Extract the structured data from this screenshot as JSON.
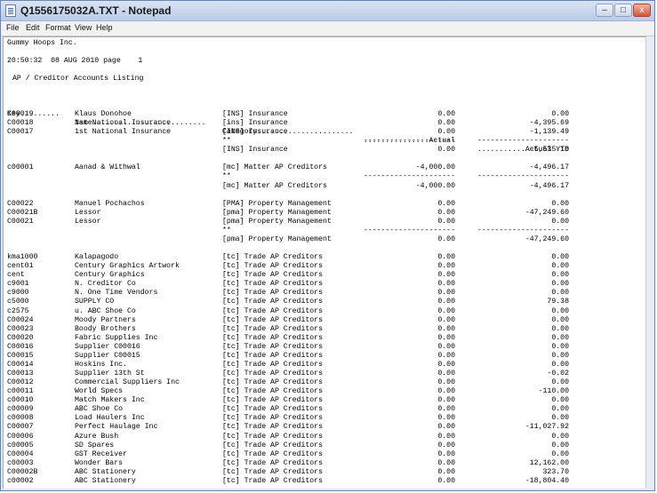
{
  "window": {
    "title": "Q1556175032A.TXT - Notepad",
    "minimize": "–",
    "maximize": "□",
    "close": "x"
  },
  "menu": [
    "File",
    "Edit",
    "Format",
    "View",
    "Help"
  ],
  "report": {
    "company": "Gummy Hoops Inc.",
    "timestamp": "20:50:32  08 AUG 2010 page    1",
    "title": "AP / Creditor Accounts Listing",
    "headers": {
      "key": "Key.........",
      "name": "Name..........................",
      "category": "Category......................",
      "actual": "...............Actual",
      "ytd": "...........Actual YTD"
    },
    "rows": [
      {
        "key": "C00019",
        "name": "Klaus Donohoe",
        "cat": "[INS] Insurance",
        "actual": "0.00",
        "ytd": "0.00"
      },
      {
        "key": "C00018",
        "name": "1st National Insurance",
        "cat": "[ins] Insurance",
        "actual": "0.00",
        "ytd": "-4,395.69"
      },
      {
        "key": "C00017",
        "name": "1st National Insurance",
        "cat": "[INS] Insurance",
        "actual": "0.00",
        "ytd": "-1,139.49"
      },
      {
        "key": "",
        "name": "",
        "cat": "**",
        "actual": "---------------------",
        "ytd": "---------------------"
      },
      {
        "key": "",
        "name": "",
        "cat": "[INS] Insurance",
        "actual": "0.00",
        "ytd": "-5,535.18"
      },
      {
        "blank": true
      },
      {
        "key": "c00001",
        "name": "Aanad & Withwal",
        "cat": "[mc] Matter AP Creditors",
        "actual": "-4,000.00",
        "ytd": "-4,496.17"
      },
      {
        "key": "",
        "name": "",
        "cat": "**",
        "actual": "---------------------",
        "ytd": "---------------------"
      },
      {
        "key": "",
        "name": "",
        "cat": "[mc] Matter AP Creditors",
        "actual": "-4,000.00",
        "ytd": "-4,496.17"
      },
      {
        "blank": true
      },
      {
        "key": "C00022",
        "name": "Manuel Pochachos",
        "cat": "[PMA] Property Management",
        "actual": "0.00",
        "ytd": "0.00"
      },
      {
        "key": "C00021B",
        "name": "Lessor",
        "cat": "[pma] Property Management",
        "actual": "0.00",
        "ytd": "-47,249.60"
      },
      {
        "key": "C00021",
        "name": "Lessor",
        "cat": "[pma] Property Management",
        "actual": "0.00",
        "ytd": "0.00"
      },
      {
        "key": "",
        "name": "",
        "cat": "**",
        "actual": "---------------------",
        "ytd": "---------------------"
      },
      {
        "key": "",
        "name": "",
        "cat": "[pma] Property Management",
        "actual": "0.00",
        "ytd": "-47,249.60"
      },
      {
        "blank": true
      },
      {
        "key": "kma1000",
        "name": "Kalapagodo",
        "cat": "[tc] Trade AP Creditors",
        "actual": "0.00",
        "ytd": "0.00"
      },
      {
        "key": "cent01",
        "name": "Century Graphics Artwork",
        "cat": "[tc] Trade AP Creditors",
        "actual": "0.00",
        "ytd": "0.00"
      },
      {
        "key": "cent",
        "name": "Century Graphics",
        "cat": "[tc] Trade AP Creditors",
        "actual": "0.00",
        "ytd": "0.00"
      },
      {
        "key": "c9001",
        "name": "N. Creditor Co",
        "cat": "[tc] Trade AP Creditors",
        "actual": "0.00",
        "ytd": "0.00"
      },
      {
        "key": "c9000",
        "name": "N. One Time Vendors",
        "cat": "[tc] Trade AP Creditors",
        "actual": "0.00",
        "ytd": "0.00"
      },
      {
        "key": "c5000",
        "name": "SUPPLY CO",
        "cat": "[tc] Trade AP Creditors",
        "actual": "0.00",
        "ytd": "79.38"
      },
      {
        "key": "c2575",
        "name": "u. ABC Shoe Co",
        "cat": "[tc] Trade AP Creditors",
        "actual": "0.00",
        "ytd": "0.00"
      },
      {
        "key": "C00024",
        "name": "Moody Partners",
        "cat": "[tc] Trade AP Creditors",
        "actual": "0.00",
        "ytd": "0.00"
      },
      {
        "key": "C00023",
        "name": "Boody Brothers",
        "cat": "[tc] Trade AP Creditors",
        "actual": "0.00",
        "ytd": "0.00"
      },
      {
        "key": "C00020",
        "name": "Fabric Supplies Inc",
        "cat": "[tc] Trade AP Creditors",
        "actual": "0.00",
        "ytd": "0.00"
      },
      {
        "key": "C00016",
        "name": "Supplier C00016",
        "cat": "[tc] Trade AP Creditors",
        "actual": "0.00",
        "ytd": "0.00"
      },
      {
        "key": "C00015",
        "name": "Supplier C00015",
        "cat": "[tc] Trade AP Creditors",
        "actual": "0.00",
        "ytd": "0.00"
      },
      {
        "key": "C00014",
        "name": "Hoskins Inc.",
        "cat": "[tc] Trade AP Creditors",
        "actual": "0.00",
        "ytd": "0.00"
      },
      {
        "key": "C00013",
        "name": "Supplier 13th St",
        "cat": "[tc] Trade AP Creditors",
        "actual": "0.00",
        "ytd": "-0.02"
      },
      {
        "key": "C00012",
        "name": "Commercial Suppliers Inc",
        "cat": "[tc] Trade AP Creditors",
        "actual": "0.00",
        "ytd": "0.00"
      },
      {
        "key": "c00011",
        "name": "World Specs",
        "cat": "[tc] Trade AP Creditors",
        "actual": "0.00",
        "ytd": "-110.00"
      },
      {
        "key": "c00010",
        "name": "Match Makers Inc",
        "cat": "[tc] Trade AP Creditors",
        "actual": "0.00",
        "ytd": "0.00"
      },
      {
        "key": "c00009",
        "name": "ABC Shoe Co",
        "cat": "[tc] Trade AP Creditors",
        "actual": "0.00",
        "ytd": "0.00"
      },
      {
        "key": "c00008",
        "name": "Load Haulers Inc",
        "cat": "[tc] Trade AP Creditors",
        "actual": "0.00",
        "ytd": "0.00"
      },
      {
        "key": "C00007",
        "name": "Perfect Haulage Inc",
        "cat": "[tc] Trade AP Creditors",
        "actual": "0.00",
        "ytd": "-11,027.92"
      },
      {
        "key": "C00006",
        "name": "Azure Bush",
        "cat": "[tc] Trade AP Creditors",
        "actual": "0.00",
        "ytd": "0.00"
      },
      {
        "key": "c00005",
        "name": "SD Spares",
        "cat": "[tc] Trade AP Creditors",
        "actual": "0.00",
        "ytd": "0.00"
      },
      {
        "key": "C00004",
        "name": "GST Receiver",
        "cat": "[tc] Trade AP Creditors",
        "actual": "0.00",
        "ytd": "0.00"
      },
      {
        "key": "c00003",
        "name": "Wonder Bars",
        "cat": "[tc] Trade AP Creditors",
        "actual": "0.00",
        "ytd": "12,162.00"
      },
      {
        "key": "C00002B",
        "name": "ABC Stationery",
        "cat": "[tc] Trade AP Creditors",
        "actual": "0.00",
        "ytd": "323.70"
      },
      {
        "key": "c00002",
        "name": "ABC Stationery",
        "cat": "[tc] Trade AP Creditors",
        "actual": "0.00",
        "ytd": "-18,804.40"
      }
    ]
  }
}
